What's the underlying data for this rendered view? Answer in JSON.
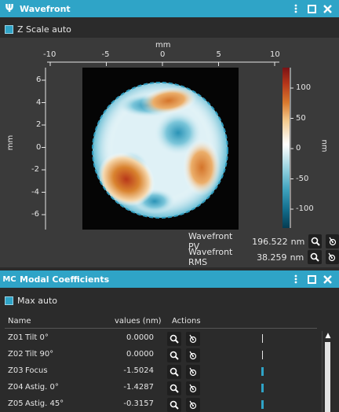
{
  "wavefront_window": {
    "title": "Wavefront",
    "icon": "psi-icon",
    "z_scale_auto_label": "Z Scale auto",
    "x_axis_label": "mm",
    "x_ticks": [
      "-10",
      "-5",
      "0",
      "5",
      "10"
    ],
    "y_axis_label": "mm",
    "y_ticks": [
      "6",
      "4",
      "2",
      "0",
      "-2",
      "-4",
      "-6"
    ],
    "colorbar_label": "nm",
    "colorbar_ticks": [
      "100",
      "50",
      "0",
      "-50",
      "-100"
    ],
    "pv_label": "Wavefront PV",
    "pv_value": "196.522",
    "pv_unit": "nm",
    "rms_label": "Wavefront RMS",
    "rms_value": "38.259",
    "rms_unit": "nm",
    "accent_color": "#2fa4c7"
  },
  "modal_window": {
    "title": "Modal Coefficients",
    "icon": "mc-icon",
    "max_auto_label": "Max auto",
    "columns": [
      "Name",
      "values (nm)",
      "Actions"
    ],
    "rows": [
      {
        "code": "Z01",
        "name": "Tilt 0°",
        "value": "0.0000",
        "bar_fraction": 0
      },
      {
        "code": "Z02",
        "name": "Tilt 90°",
        "value": "0.0000",
        "bar_fraction": 0
      },
      {
        "code": "Z03",
        "name": "Focus",
        "value": "-1.5024",
        "bar_fraction": 0.045
      },
      {
        "code": "Z04",
        "name": "Astig. 0°",
        "value": "-1.4287",
        "bar_fraction": 0.035
      },
      {
        "code": "Z05",
        "name": "Astig. 45°",
        "value": "-0.3157",
        "bar_fraction": 0.01
      }
    ]
  }
}
